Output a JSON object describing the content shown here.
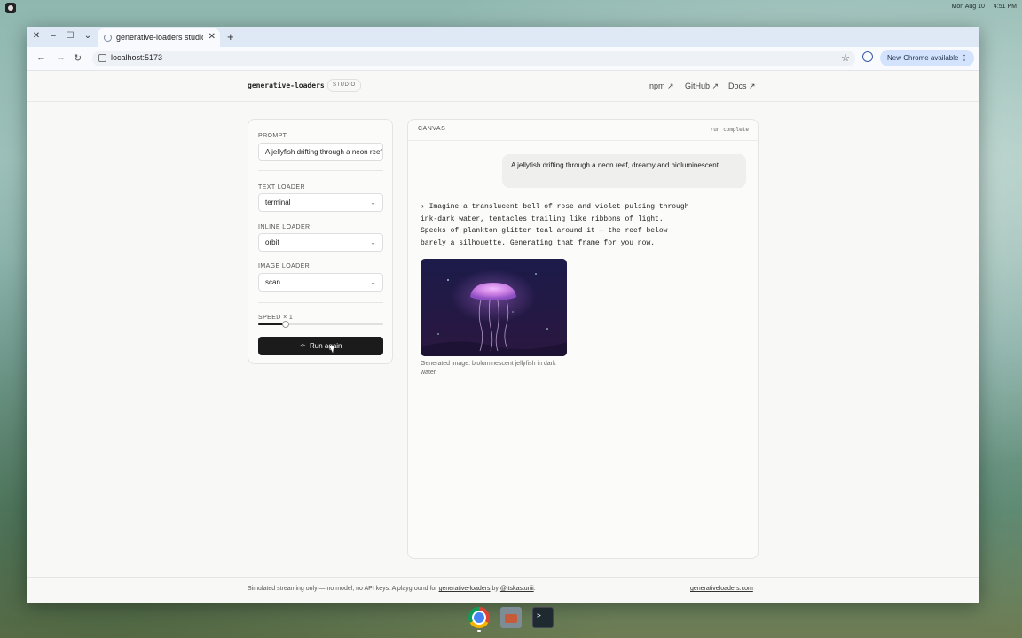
{
  "system": {
    "date": "Mon Aug 10",
    "time": "4:51 PM"
  },
  "browser": {
    "tab_title": "generative-loaders studio",
    "url": "localhost:5173",
    "update_label": "New Chrome available"
  },
  "header": {
    "brand": "generative-loaders",
    "badge": "STUDIO",
    "nav": [
      "npm ↗",
      "GitHub ↗",
      "Docs ↗"
    ]
  },
  "controls": {
    "prompt_label": "PROMPT",
    "prompt_value": "A jellyfish drifting through a neon reef, dreamy and bioluminescent.",
    "text_loader_label": "TEXT LOADER",
    "text_loader_value": "terminal",
    "inline_loader_label": "INLINE LOADER",
    "inline_loader_value": "orbit",
    "image_loader_label": "IMAGE LOADER",
    "image_loader_value": "scan",
    "speed_label": "SPEED × 1",
    "speed_fraction": 0.22,
    "run_label": "Run again"
  },
  "canvas": {
    "title": "CANVAS",
    "status": "run complete",
    "user_message": "A jellyfish drifting through a neon reef, dreamy and bioluminescent.",
    "response": "› Imagine a translucent bell of rose and violet pulsing through\nink-dark water, tentacles trailing like ribbons of light.\nSpecks of plankton glitter teal around it — the reef below\nbarely a silhouette. Generating that frame for you now.",
    "image_caption": "Generated image: bioluminescent jellyfish in dark water"
  },
  "footer": {
    "text_before": "Simulated streaming only — no model, no API keys. A playground for ",
    "link1": "generative-loaders",
    "text_mid": " by ",
    "link2": "@itskasturiii",
    "text_after": ".",
    "site_link": "generativeloaders.com"
  },
  "dock": [
    "chrome-icon",
    "package-manager-icon",
    "terminal-icon"
  ],
  "colors": {
    "accent": "#1b1b1b",
    "chrome_update_bg": "#d3e3fd",
    "jellyfish": "#c77be0"
  }
}
